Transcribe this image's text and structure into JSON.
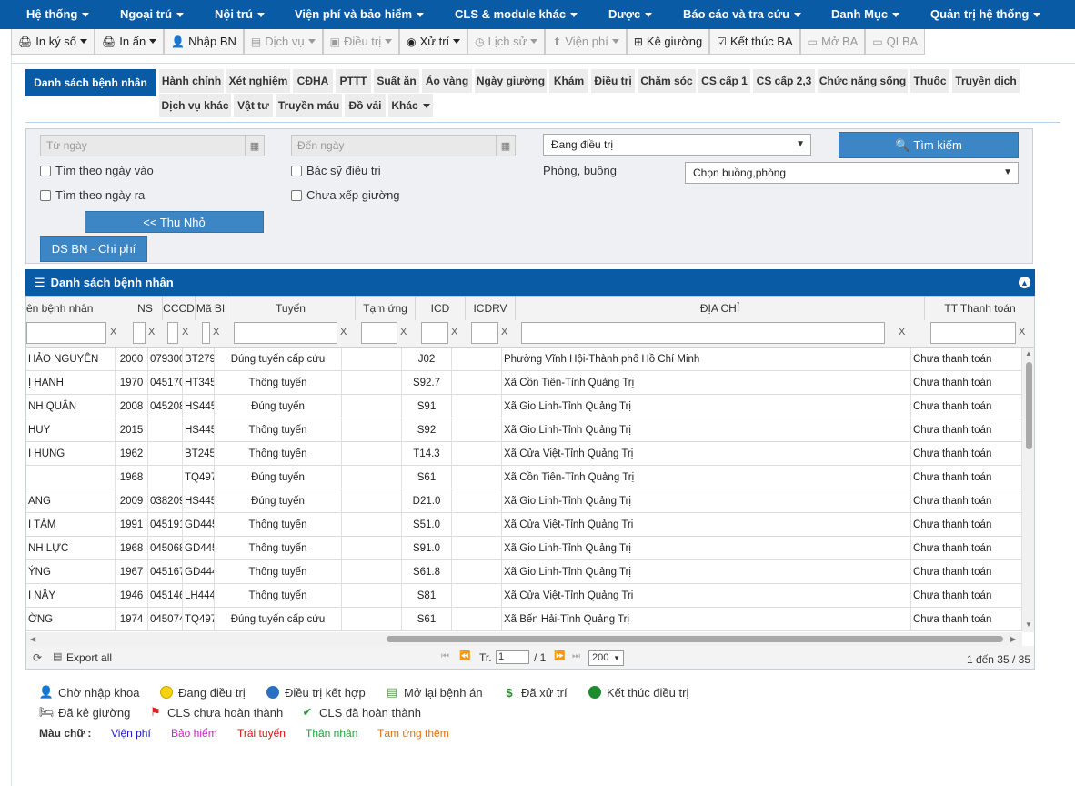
{
  "topnav": {
    "items": [
      "Hệ thống",
      "Ngoại trú",
      "Nội trú",
      "Viện phí và bảo hiểm",
      "CLS & module khác",
      "Dược",
      "Báo cáo và tra cứu",
      "Danh Mục",
      "Quản trị hệ thống"
    ]
  },
  "toolbar": {
    "items": [
      {
        "label": "In ký số",
        "icon": "printer-icon",
        "caret": true,
        "disabled": false
      },
      {
        "label": "In ấn",
        "icon": "printer-icon",
        "caret": true,
        "disabled": false
      },
      {
        "label": "Nhập BN",
        "icon": "user-add-icon",
        "caret": false,
        "disabled": false
      },
      {
        "label": "Dịch vụ",
        "icon": "list-icon",
        "caret": true,
        "disabled": true
      },
      {
        "label": "Điều trị",
        "icon": "medkit-icon",
        "caret": true,
        "disabled": true
      },
      {
        "label": "Xử trí",
        "icon": "user-circle-icon",
        "caret": true,
        "disabled": false
      },
      {
        "label": "Lịch sử",
        "icon": "history-icon",
        "caret": true,
        "disabled": true
      },
      {
        "label": "Viện phí",
        "icon": "upload-icon",
        "caret": true,
        "disabled": true
      },
      {
        "label": "Kê giường",
        "icon": "plus-square-icon",
        "caret": false,
        "disabled": false
      },
      {
        "label": "Kết thúc BA",
        "icon": "checklist-icon",
        "caret": false,
        "disabled": false
      },
      {
        "label": "Mở BA",
        "icon": "folder-open-icon",
        "caret": false,
        "disabled": true
      },
      {
        "label": "QLBA",
        "icon": "folder-open-icon",
        "caret": false,
        "disabled": true
      }
    ]
  },
  "tabs": {
    "active": "Danh sách bệnh nhân",
    "row1": [
      "Hành chính",
      "Xét nghiệm",
      "CĐHA",
      "PTTT",
      "Suất ăn",
      "Áo vàng",
      "Ngày giường",
      "Khám",
      "Điều trị",
      "Chăm sóc",
      "CS cấp 1",
      "CS cấp 2,3",
      "Chức năng sống",
      "Thuốc",
      "Truyền dịch"
    ],
    "row2": [
      "Dịch vụ khác",
      "Vật tư",
      "Truyền máu",
      "Đồ vải",
      "Khác"
    ]
  },
  "filters": {
    "from_date_placeholder": "Từ ngày",
    "to_date_placeholder": "Đến ngày",
    "status_selected": "Đang điều trị",
    "search_button": "Tìm kiếm",
    "chk_admit_date": "Tìm theo ngày vào",
    "chk_discharge_date": "Tìm theo ngày ra",
    "chk_doctor": "Bác sỹ điều trị",
    "chk_no_bed": "Chưa xếp giường",
    "room_label": "Phòng, buồng",
    "room_selected": "Chọn buồng,phòng",
    "collapse_button": "<< Thu Nhỏ",
    "cost_button": "DS BN - Chi phí"
  },
  "grid": {
    "title": "Danh sách bệnh nhân",
    "columns": [
      "ên bệnh nhân",
      "NS",
      "CCCD",
      "Mã BI",
      "Tuyến",
      "Tạm ứng",
      "ICD",
      "ICDRV",
      "ĐỊA CHỈ",
      "TT Thanh toán"
    ],
    "filter_clear": "X",
    "rows": [
      {
        "name": "HẢO NGUYÊN",
        "ns": "2000",
        "cccd": "079300",
        "mabi": "BT279",
        "tuyen": "Đúng tuyến cấp cứu",
        "icd": "J02",
        "diachi": "Phường Vĩnh Hội-Thành phố Hồ Chí Minh",
        "tt": "Chưa thanh toán"
      },
      {
        "name": "Ị HẠNH",
        "ns": "1970",
        "cccd": "045170",
        "mabi": "HT345",
        "tuyen": "Thông tuyến",
        "icd": "S92.7",
        "diachi": "Xã Cồn Tiên-Tỉnh Quảng Trị",
        "tt": "Chưa thanh toán"
      },
      {
        "name": "NH QUÂN",
        "ns": "2008",
        "cccd": "045208",
        "mabi": "HS445",
        "tuyen": "Đúng tuyến",
        "icd": "S91",
        "diachi": "Xã Gio Linh-Tỉnh Quảng Trị",
        "tt": "Chưa thanh toán"
      },
      {
        "name": "HUY",
        "ns": "2015",
        "cccd": "",
        "mabi": "HS445",
        "tuyen": "Thông tuyến",
        "icd": "S92",
        "diachi": "Xã Gio Linh-Tỉnh Quảng Trị",
        "tt": "Chưa thanh toán"
      },
      {
        "name": "I HÙNG",
        "ns": "1962",
        "cccd": "",
        "mabi": "BT245",
        "tuyen": "Thông tuyến",
        "icd": "T14.3",
        "diachi": "Xã Cửa Việt-Tỉnh Quảng Trị",
        "tt": "Chưa thanh toán"
      },
      {
        "name": "",
        "ns": "1968",
        "cccd": "",
        "mabi": "TQ497",
        "tuyen": "Đúng tuyến",
        "icd": "S61",
        "diachi": "Xã Cồn Tiên-Tỉnh Quảng Trị",
        "tt": "Chưa thanh toán"
      },
      {
        "name": "ANG",
        "ns": "2009",
        "cccd": "038209",
        "mabi": "HS445",
        "tuyen": "Đúng tuyến",
        "icd": "D21.0",
        "diachi": "Xã Gio Linh-Tỉnh Quảng Trị",
        "tt": "Chưa thanh toán"
      },
      {
        "name": "Ị TÂM",
        "ns": "1991",
        "cccd": "045191",
        "mabi": "GD445",
        "tuyen": "Thông tuyến",
        "icd": "S51.0",
        "diachi": "Xã Cửa Việt-Tỉnh Quảng Trị",
        "tt": "Chưa thanh toán"
      },
      {
        "name": "NH LỰC",
        "ns": "1968",
        "cccd": "045068",
        "mabi": "GD445",
        "tuyen": "Thông tuyến",
        "icd": "S91.0",
        "diachi": "Xã Gio Linh-Tỉnh Quảng Trị",
        "tt": "Chưa thanh toán"
      },
      {
        "name": "ÝNG",
        "ns": "1967",
        "cccd": "045167",
        "mabi": "GD444",
        "tuyen": "Thông tuyến",
        "icd": "S61.8",
        "diachi": "Xã Gio Linh-Tỉnh Quảng Trị",
        "tt": "Chưa thanh toán"
      },
      {
        "name": "I NẦY",
        "ns": "1946",
        "cccd": "045146",
        "mabi": "LH444",
        "tuyen": "Thông tuyến",
        "icd": "S81",
        "diachi": "Xã Cửa Việt-Tỉnh Quảng Trị",
        "tt": "Chưa thanh toán"
      },
      {
        "name": "ỜNG",
        "ns": "1974",
        "cccd": "045074",
        "mabi": "TQ497",
        "tuyen": "Đúng tuyến cấp cứu",
        "icd": "S61",
        "diachi": "Xã Bến Hải-Tỉnh Quảng Trị",
        "tt": "Chưa thanh toán"
      }
    ],
    "pager": {
      "export": "Export all",
      "page_prefix": "Tr.",
      "page_value": "1",
      "page_total": "/ 1",
      "page_size": "200",
      "summary": "1 đến 35 / 35"
    }
  },
  "legend": {
    "row1": [
      {
        "label": "Chờ nhập khoa",
        "icon": "user-wait-icon"
      },
      {
        "label": "Đang điều trị",
        "icon": "yellow-circle-icon"
      },
      {
        "label": "Điều trị kết hợp",
        "icon": "globe-icon"
      },
      {
        "label": "Mở lại bệnh án",
        "icon": "document-icon"
      },
      {
        "label": "Đã xử trí",
        "icon": "dollar-icon"
      },
      {
        "label": "Kết thúc điều trị",
        "icon": "green-circle-icon"
      }
    ],
    "row2": [
      {
        "label": "Đã kê giường",
        "icon": "bed-icon"
      },
      {
        "label": "CLS chưa hoàn thành",
        "icon": "red-flag-icon"
      },
      {
        "label": "CLS đã hoàn thành",
        "icon": "green-check-icon"
      }
    ],
    "color_label": "Màu chữ :",
    "colors": [
      {
        "label": "Viện phí",
        "color": "#1a1acc"
      },
      {
        "label": "Bảo hiểm",
        "color": "#cc22cc"
      },
      {
        "label": "Trái tuyến",
        "color": "#dd1111"
      },
      {
        "label": "Thân nhân",
        "color": "#22a03a"
      },
      {
        "label": "Tạm ứng thêm",
        "color": "#e07010"
      }
    ]
  }
}
